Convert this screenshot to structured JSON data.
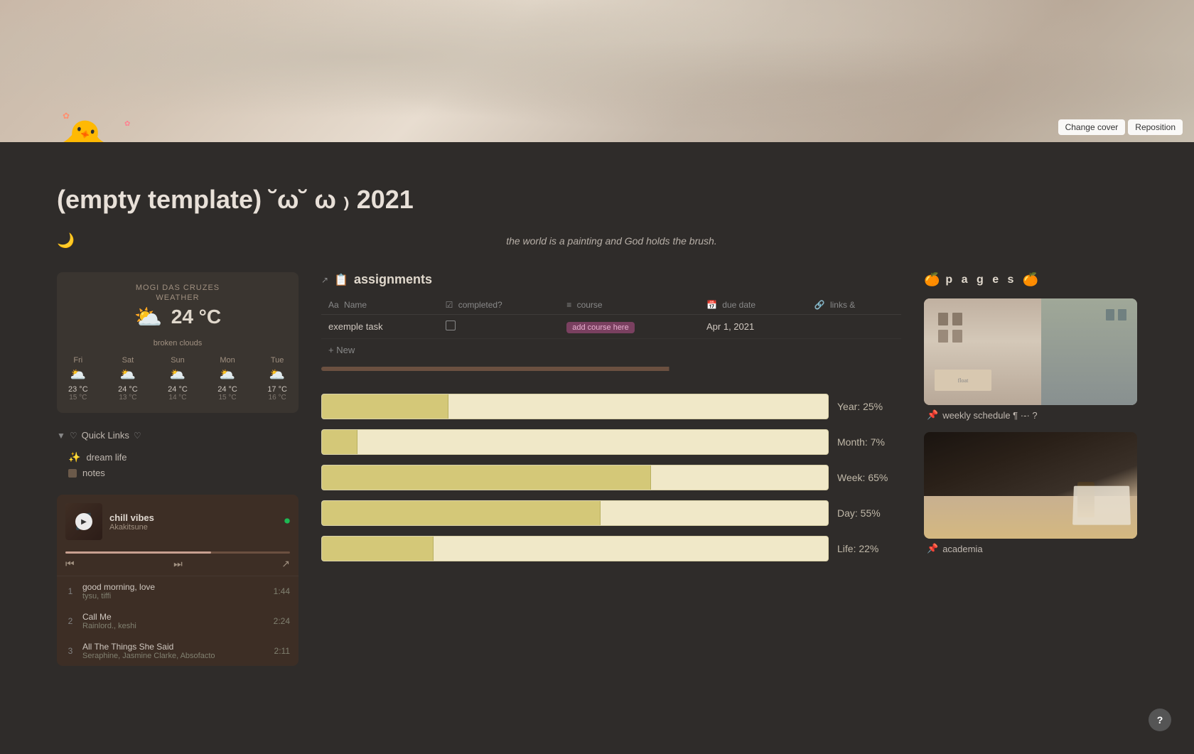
{
  "cover": {
    "change_cover_label": "Change cover",
    "reposition_label": "Reposition"
  },
  "page": {
    "icon": "🐣",
    "title": "(empty template) ˘ω˘ ω ₎ 2021",
    "quote": "the world is a painting and God holds the brush."
  },
  "weather": {
    "location": "MOGI DAS CRUZES",
    "subtitle": "WEATHER",
    "temp": "24 °C",
    "description": "broken clouds",
    "icon": "⛅",
    "days": [
      {
        "name": "Fri",
        "icon": "🌥️",
        "high": "23 °C",
        "low": "15 °C"
      },
      {
        "name": "Sat",
        "icon": "🌥️",
        "high": "24 °C",
        "low": "13 °C"
      },
      {
        "name": "Sun",
        "icon": "🌥️",
        "high": "24 °C",
        "low": "14 °C"
      },
      {
        "name": "Mon",
        "icon": "🌥️",
        "high": "24 °C",
        "low": "15 °C"
      },
      {
        "name": "Tue",
        "icon": "🌥️",
        "high": "17 °C",
        "low": "16 °C"
      }
    ]
  },
  "quick_links": {
    "title": "Quick Links",
    "items": [
      {
        "icon": "✨",
        "type": "star",
        "label": "dream life"
      },
      {
        "icon": "■",
        "type": "square",
        "label": "notes"
      }
    ]
  },
  "music": {
    "playlist_name": "chill vibes",
    "artist": "Akakitsune",
    "tracks": [
      {
        "num": "1",
        "name": "good morning, love",
        "artists": "tysu, tiffi",
        "duration": "1:44"
      },
      {
        "num": "2",
        "name": "Call Me",
        "artists": "Rainlord., keshi",
        "duration": "2:24"
      },
      {
        "num": "3",
        "name": "All The Things She Said",
        "artists": "Seraphine, Jasmine Clarke, Absofacto",
        "duration": "2:11"
      }
    ]
  },
  "assignments": {
    "title": "assignments",
    "icon": "📋",
    "columns": [
      {
        "icon": "Aa",
        "label": "Name"
      },
      {
        "icon": "☑",
        "label": "completed?"
      },
      {
        "icon": "≡",
        "label": "course"
      },
      {
        "icon": "📅",
        "label": "due date"
      },
      {
        "icon": "🔗",
        "label": "links &"
      }
    ],
    "rows": [
      {
        "name": "exemple task",
        "completed": false,
        "course": "add course here",
        "due_date": "Apr 1, 2021",
        "links": ""
      }
    ],
    "add_label": "+ New"
  },
  "progress": {
    "bars": [
      {
        "label": "Year: 25%",
        "percent": 25
      },
      {
        "label": "Month: 7%",
        "percent": 7
      },
      {
        "label": "Week: 65%",
        "percent": 65
      },
      {
        "label": "Day: 55%",
        "percent": 55
      },
      {
        "label": "Life: 22%",
        "percent": 22
      }
    ]
  },
  "pages": {
    "title": "p a g e s",
    "items": [
      {
        "label": "weekly schedule ¶ ·-· ?",
        "icon": "📌"
      },
      {
        "label": "academia",
        "icon": "📌"
      }
    ]
  },
  "help": "?"
}
